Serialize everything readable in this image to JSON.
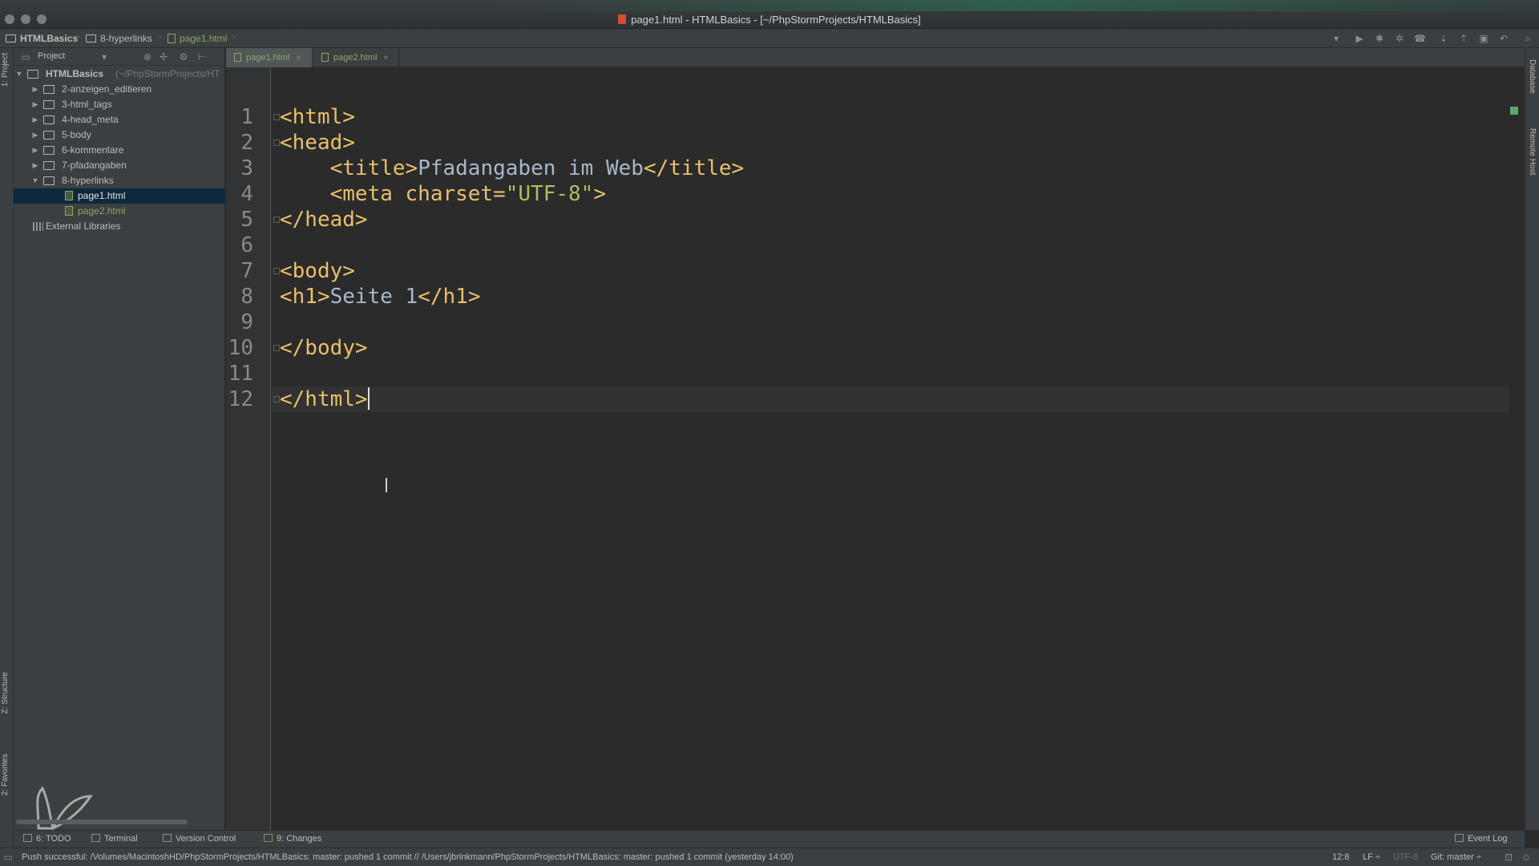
{
  "window": {
    "title": "page1.html - HTMLBasics - [~/PhpStormProjects/HTMLBasics]"
  },
  "breadcrumbs": [
    "HTMLBasics",
    "8-hyperlinks",
    "page1.html"
  ],
  "project_panel": {
    "title": "Project",
    "root": {
      "name": "HTMLBasics",
      "path_hint": "(~/PhpStormProjects/HT"
    },
    "folders": [
      "2-anzeigen_editieren",
      "3-html_tags",
      "4-head_meta",
      "5-body",
      "6-kommentare",
      "7-pfadangaben",
      "8-hyperlinks"
    ],
    "files": [
      "page1.html",
      "page2.html"
    ],
    "external": "External Libraries"
  },
  "tabs": [
    {
      "label": "page1.html",
      "active": true
    },
    {
      "label": "page2.html",
      "active": false
    }
  ],
  "code": {
    "line_numbers": [
      "1",
      "2",
      "3",
      "4",
      "5",
      "6",
      "7",
      "8",
      "9",
      "10",
      "11",
      "12"
    ],
    "lines": {
      "l1": "<html>",
      "l2": "<head>",
      "l3a": "    <title>",
      "l3b": "Pfadangaben im Web",
      "l3c": "</title>",
      "l4a": "    <meta charset=",
      "l4b": "\"UTF-8\"",
      "l4c": ">",
      "l5": "</head>",
      "l7": "<body>",
      "l8a": "<h1>",
      "l8b": "Seite 1",
      "l8c": "</h1>",
      "l10": "</body>",
      "l12": "</html>"
    }
  },
  "left_stripe": {
    "project": "1: Project",
    "structure": "Z: Structure",
    "favorites": "2: Favorites"
  },
  "right_stripe": {
    "database": "Database",
    "remote": "Remote Host"
  },
  "bottom_tools": {
    "todo": "6: TODO",
    "terminal": "Terminal",
    "vcs": "Version Control",
    "changes": "9: Changes",
    "event_log": "Event Log"
  },
  "status": {
    "message": "Push successful: /Volumes/MacintoshHD/PhpStormProjects/HTMLBasics: master: pushed 1 commit // /Users/jbrinkmann/PhpStormProjects/HTMLBasics: master: pushed 1 commit (yesterday 14:00)",
    "position": "12:8",
    "line_sep": "LF ÷",
    "encoding": "UTF-8",
    "git": "Git: master ÷"
  },
  "colors": {
    "editor_bg": "#2b2b2b",
    "tag": "#e8bf6a",
    "text": "#a9b7c6",
    "string": "#a5c25c",
    "selection": "#0d293e"
  }
}
